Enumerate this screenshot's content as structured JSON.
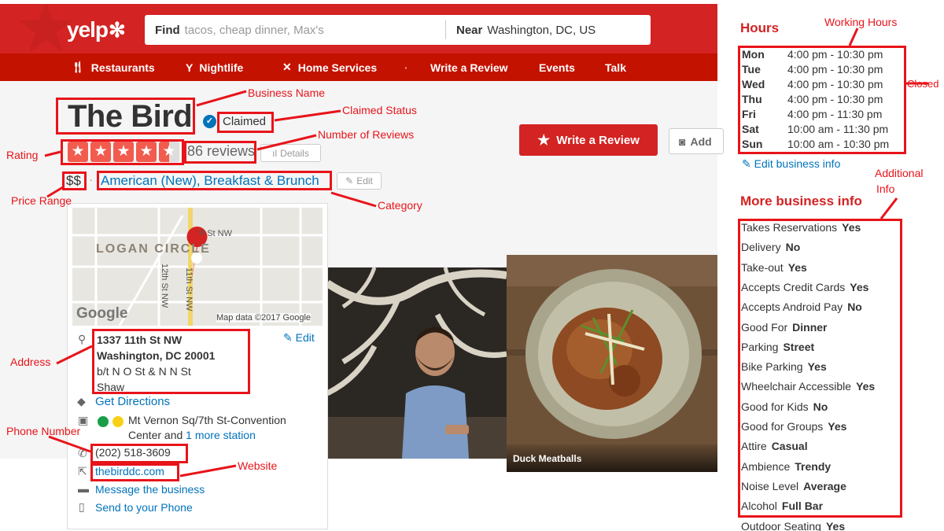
{
  "header": {
    "logo_text": "yelp",
    "search_find_label": "Find",
    "search_find_placeholder": "tacos, cheap dinner, Max's",
    "search_near_label": "Near",
    "search_near_value": "Washington, DC, US",
    "brand_color": "#d32323"
  },
  "nav": {
    "items": [
      {
        "label": "Restaurants",
        "icon": "fork-knife-icon"
      },
      {
        "label": "Nightlife",
        "icon": "cocktail-icon"
      },
      {
        "label": "Home Services",
        "icon": "tools-icon"
      },
      {
        "label": "Write a Review"
      },
      {
        "label": "Events"
      },
      {
        "label": "Talk"
      }
    ]
  },
  "business": {
    "name": "The Bird",
    "claimed_label": "Claimed",
    "rating_stars": 4.5,
    "reviews_label": "86 reviews",
    "details_label": "Details",
    "price_range": "$$",
    "price_separator": "·",
    "category": "American (New), Breakfast & Brunch",
    "edit_label": "Edit",
    "write_review_label": "Write a Review",
    "add_photo_label": "Add"
  },
  "map_card": {
    "map_labels": {
      "area": "LOGAN CIRCLE",
      "street_p": "P St NW",
      "street_12": "12th St NW",
      "street_11": "11th St NW",
      "attribution": "Map data ©2017 Google",
      "google": "Google"
    },
    "address_line1": "1337 11th St NW",
    "address_line2": "Washington, DC 20001",
    "cross_streets": "b/t N O St & N N St",
    "neighborhood": "Shaw",
    "edit_label": "Edit",
    "get_directions": "Get Directions",
    "transit_line1": "Mt Vernon Sq/7th St-Convention",
    "transit_line2_prefix": "Center and ",
    "transit_more": "1 more station",
    "phone": "(202) 518-3609",
    "website": "thebirddc.com",
    "message": "Message the business",
    "send_to_phone": "Send to your Phone"
  },
  "photos": {
    "caption": "Duck Meatballs"
  },
  "sidebar": {
    "hours_title": "Hours",
    "hours": [
      {
        "day": "Mon",
        "time": "4:00 pm - 10:30 pm"
      },
      {
        "day": "Tue",
        "time": "4:00 pm - 10:30 pm"
      },
      {
        "day": "Wed",
        "time": "4:00 pm - 10:30 pm"
      },
      {
        "day": "Thu",
        "time": "4:00 pm - 10:30 pm"
      },
      {
        "day": "Fri",
        "time": "4:00 pm - 11:30 pm"
      },
      {
        "day": "Sat",
        "time": "10:00 am - 11:30 pm"
      },
      {
        "day": "Sun",
        "time": "10:00 am - 10:30 pm"
      }
    ],
    "edit_info": "Edit business info",
    "more_title": "More business info",
    "info": [
      {
        "k": "Takes Reservations",
        "v": "Yes"
      },
      {
        "k": "Delivery",
        "v": "No"
      },
      {
        "k": "Take-out",
        "v": "Yes"
      },
      {
        "k": "Accepts Credit Cards",
        "v": "Yes"
      },
      {
        "k": "Accepts Android Pay",
        "v": "No"
      },
      {
        "k": "Good For",
        "v": "Dinner"
      },
      {
        "k": "Parking",
        "v": "Street"
      },
      {
        "k": "Bike Parking",
        "v": "Yes"
      },
      {
        "k": "Wheelchair Accessible",
        "v": "Yes"
      },
      {
        "k": "Good for Kids",
        "v": "No"
      },
      {
        "k": "Good for Groups",
        "v": "Yes"
      },
      {
        "k": "Attire",
        "v": "Casual"
      },
      {
        "k": "Ambience",
        "v": "Trendy"
      },
      {
        "k": "Noise Level",
        "v": "Average"
      },
      {
        "k": "Alcohol",
        "v": "Full Bar"
      },
      {
        "k": "Outdoor Seating",
        "v": "Yes"
      }
    ]
  },
  "annotations": {
    "business_name": "Business Name",
    "claimed_status": "Claimed Status",
    "number_of_reviews": "Number of Reviews",
    "rating": "Rating",
    "price_range": "Price Range",
    "category": "Category",
    "address": "Address",
    "phone_number": "Phone Number",
    "website": "Website",
    "working_hours": "Working Hours",
    "closed": "Closed",
    "additional_info_1": "Additional",
    "additional_info_2": "Info",
    "color": "#e8141a"
  }
}
